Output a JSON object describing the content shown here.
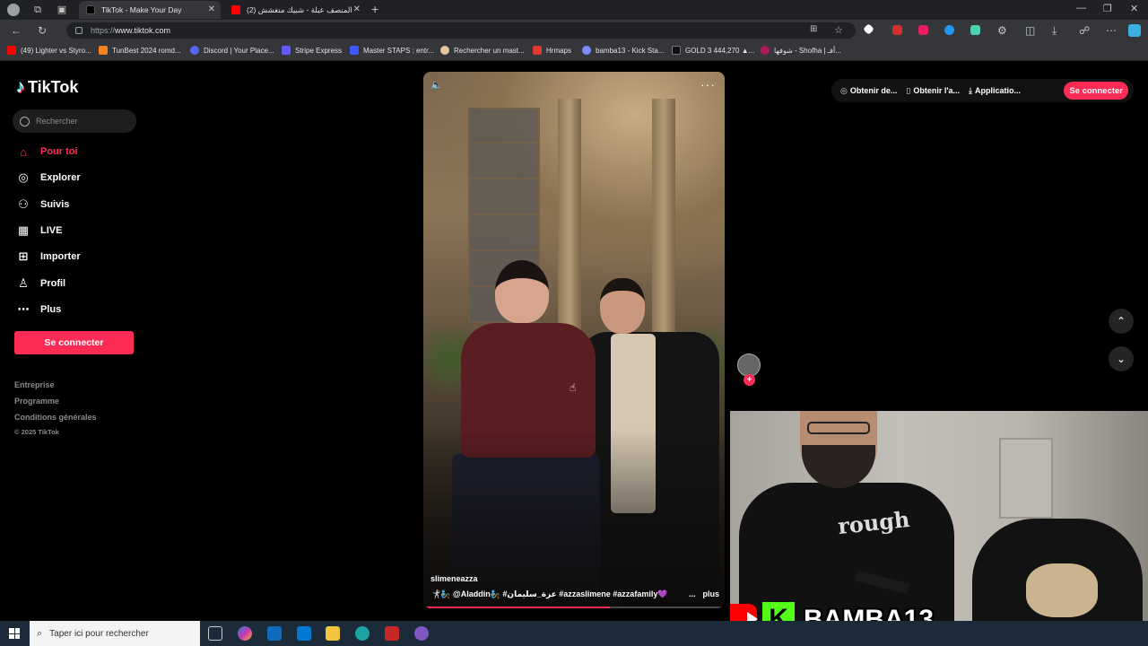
{
  "browser": {
    "tabs": [
      {
        "title": "TikTok - Make Your Day",
        "active": true
      },
      {
        "title": "(2) المنصف عبلة - شبيك متغشش",
        "active": false
      }
    ],
    "url_scheme": "https://",
    "url_host": "www.tiktok.com",
    "bookmarks": [
      {
        "label": "(49) Lighter vs Styro...",
        "color": "#ff0000"
      },
      {
        "label": "TunBest 2024 romd...",
        "color": "#f58220"
      },
      {
        "label": "Discord | Your Place...",
        "color": "#5865f2"
      },
      {
        "label": "Stripe Express",
        "color": "#635bff"
      },
      {
        "label": "Master STAPS : entr...",
        "color": "#3d5afe"
      },
      {
        "label": "Rechercher un mast...",
        "color": "#e8c39e"
      },
      {
        "label": "Hrmaps",
        "color": "#e53935"
      },
      {
        "label": "bamba13 - Kick Sta...",
        "color": "#7c8cff"
      },
      {
        "label": "GOLD 3 444,270 ▲...",
        "color": "#111111"
      },
      {
        "label": "شوفها - Shofha | أفـ...",
        "color": "#b3165a"
      }
    ]
  },
  "sidebar": {
    "logo_text": "TikTok",
    "search_placeholder": "Rechercher",
    "nav": [
      {
        "label": "Pour toi",
        "icon": "home-icon",
        "active": true
      },
      {
        "label": "Explorer",
        "icon": "compass-icon",
        "active": false
      },
      {
        "label": "Suivis",
        "icon": "following-icon",
        "active": false
      },
      {
        "label": "LIVE",
        "icon": "live-icon",
        "active": false
      },
      {
        "label": "Importer",
        "icon": "upload-icon",
        "active": false
      },
      {
        "label": "Profil",
        "icon": "profile-icon",
        "active": false
      },
      {
        "label": "Plus",
        "icon": "more-icon",
        "active": false
      }
    ],
    "login_label": "Se connecter",
    "footer_links": [
      "Entreprise",
      "Programme",
      "Conditions générales"
    ],
    "copyright": "© 2025 TikTok"
  },
  "video": {
    "author": "slimeneazza",
    "caption": "🤺🧞 @Aladdin🧞 #عزة_سليمان #azzaslimene #azzafamily💜",
    "ellipsis": "...",
    "more_label": "plus",
    "progress": 0.62
  },
  "top_actions": {
    "items": [
      {
        "label": "Obtenir de...",
        "icon": "coin-icon"
      },
      {
        "label": "Obtenir l'a...",
        "icon": "phone-icon"
      },
      {
        "label": "Applicatio...",
        "icon": "download-icon"
      }
    ],
    "login_label": "Se connecter"
  },
  "webcam": {
    "streamer_name": "BAMBA13",
    "kick_letter": "K",
    "shirt_text": "rough"
  },
  "taskbar": {
    "search_placeholder": "Taper ici pour rechercher"
  },
  "colors": {
    "accent": "#fe2c55",
    "chrome_dark": "#202124",
    "chrome": "#35363a",
    "kick_green": "#53fc18"
  }
}
